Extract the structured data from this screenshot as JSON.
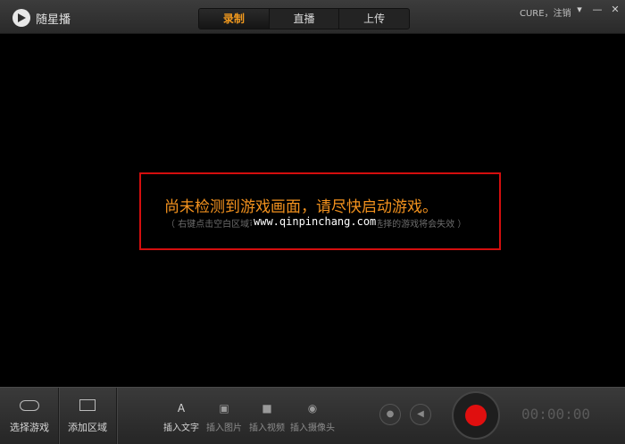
{
  "app": {
    "title": "随星播"
  },
  "tabs": [
    {
      "label": "录制",
      "active": true
    },
    {
      "label": "直播",
      "active": false
    },
    {
      "label": "上传",
      "active": false
    }
  ],
  "user": {
    "text": "CURE，注销"
  },
  "notice": {
    "main": "尚未检测到游戏画面，请尽快启动游戏。",
    "sub": "（ 右键点击空白区域可以选择游戏，选择区域后，已选择的游戏将会失效 ）",
    "watermark": "www.qinpinchang.com"
  },
  "toolbar": {
    "select_game": "选择游戏",
    "add_area": "添加区域",
    "insert_text": "插入文字",
    "insert_image": "插入图片",
    "insert_video": "插入视频",
    "insert_camera": "插入摄像头",
    "timer": "00:00:00"
  },
  "colors": {
    "accent": "#f39a1e",
    "record": "#e00f0f",
    "notice_border": "#d40e0e"
  }
}
